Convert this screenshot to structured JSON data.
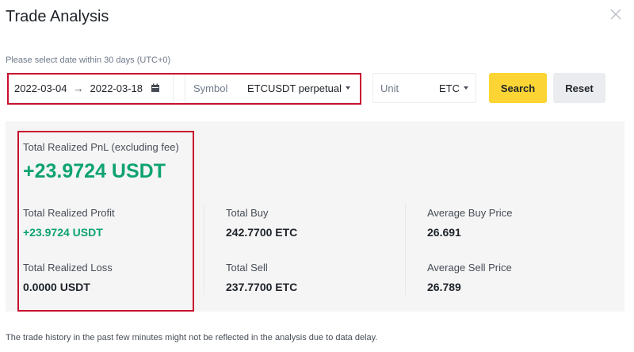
{
  "title": "Trade Analysis",
  "hint": "Please select date within 30 days (UTC+0)",
  "date_range": {
    "start": "2022-03-04",
    "arrow": "→",
    "end": "2022-03-18"
  },
  "symbol": {
    "label": "Symbol",
    "value": "ETCUSDT perpetual"
  },
  "unit": {
    "label": "Unit",
    "value": "ETC"
  },
  "buttons": {
    "search": "Search",
    "reset": "Reset"
  },
  "summary": {
    "pnl_label": "Total Realized PnL (excluding fee)",
    "pnl_value": "+23.9724 USDT",
    "profit_label": "Total Realized Profit",
    "profit_value": "+23.9724 USDT",
    "loss_label": "Total Realized Loss",
    "loss_value": "0.0000 USDT",
    "buy_label": "Total Buy",
    "buy_value": "242.7700 ETC",
    "sell_label": "Total Sell",
    "sell_value": "237.7700 ETC",
    "avg_buy_label": "Average Buy Price",
    "avg_buy_value": "26.691",
    "avg_sell_label": "Average Sell Price",
    "avg_sell_value": "26.789"
  },
  "footer": "The trade history in the past few minutes might not be reflected in the analysis due to data delay.",
  "colors": {
    "positive": "#0ea371",
    "primary_button": "#fcd535",
    "highlight": "#c8102e"
  },
  "icons": {
    "close": "close-icon",
    "calendar": "calendar-icon",
    "dropdown": "chevron-down-icon"
  }
}
